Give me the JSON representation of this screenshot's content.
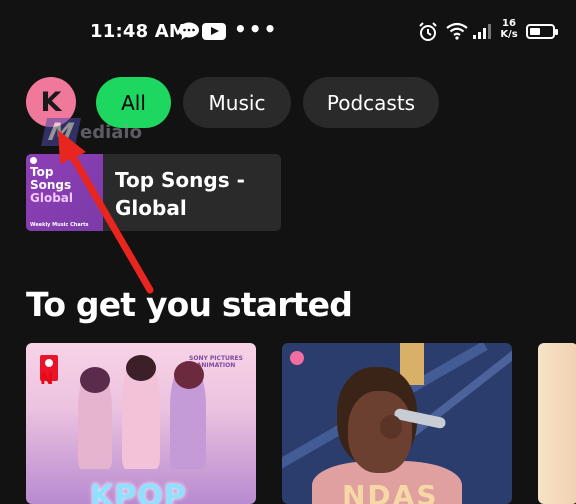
{
  "status_bar": {
    "time": "11:48 AM",
    "dots": "•••",
    "net_speed_value": "16",
    "net_speed_unit": "K/s",
    "icons": [
      "chat-bubble-icon",
      "youtube-icon",
      "alarm-icon",
      "wifi-icon",
      "signal-icon",
      "battery-icon"
    ]
  },
  "header": {
    "avatar_letter": "K",
    "chips": [
      {
        "label": "All",
        "active": true
      },
      {
        "label": "Music",
        "active": false
      },
      {
        "label": "Podcasts",
        "active": false
      }
    ],
    "watermark_letter": "M",
    "watermark_text": "ediaio"
  },
  "shortcut_card": {
    "title": "Top Songs - Global",
    "cover_line1": "Top",
    "cover_line2": "Songs",
    "cover_line3": "Global",
    "cover_footer": "Weekly Music Charts"
  },
  "section": {
    "title": "To get you started"
  },
  "tiles": [
    {
      "badge": "N",
      "label": "SONY PICTURES ANIMATION",
      "caption": "KPOP"
    },
    {
      "caption": "NDAS"
    },
    {}
  ],
  "colors": {
    "background": "#121212",
    "chip_active": "#1ed760",
    "chip_inactive": "#2a2a2a",
    "avatar": "#f0799b",
    "arrow": "#e8251f"
  }
}
